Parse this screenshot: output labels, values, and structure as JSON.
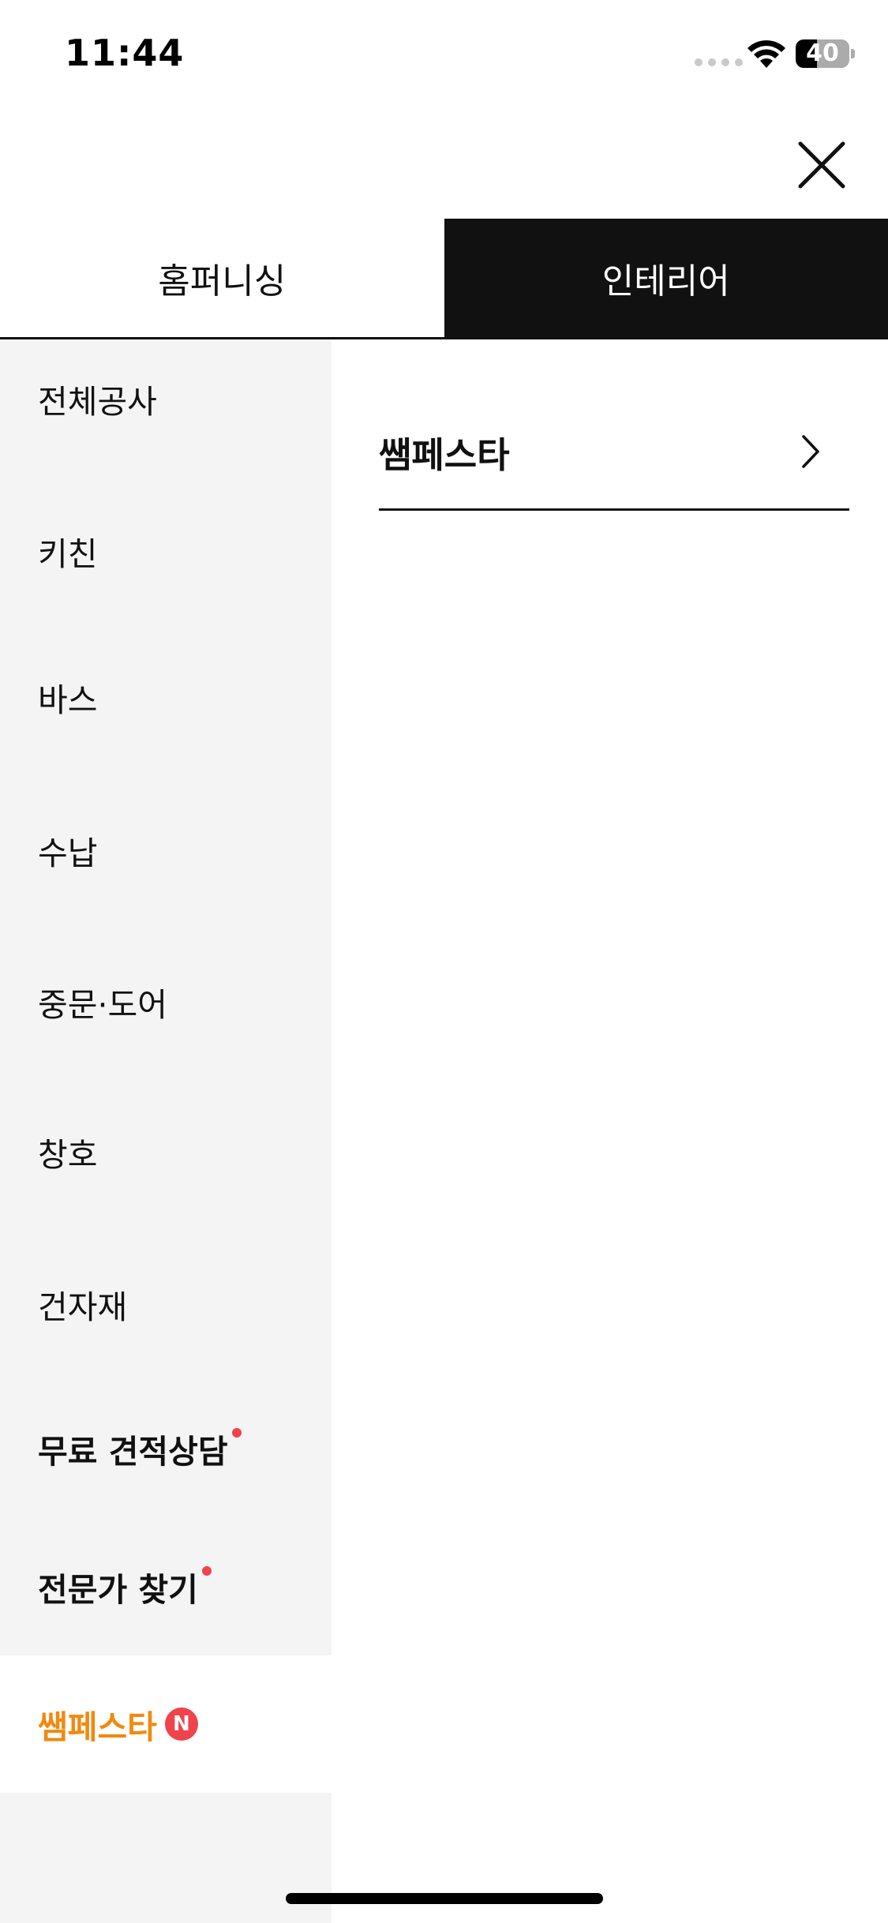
{
  "status_bar": {
    "time": "11:44",
    "battery_percent": 40,
    "battery_label": "40",
    "wifi_icon": "wifi-icon",
    "signal_icon": "cellular-signal-icon"
  },
  "close_icon": "close-icon",
  "tabs": [
    {
      "label": "홈퍼니싱",
      "active": false
    },
    {
      "label": "인테리어",
      "active": true
    }
  ],
  "sidebar": {
    "items": [
      {
        "label": "전체공사"
      },
      {
        "label": "키친"
      },
      {
        "label": "바스"
      },
      {
        "label": "수납"
      },
      {
        "label": "중문·도어"
      },
      {
        "label": "창호"
      },
      {
        "label": "건자재"
      },
      {
        "label": "무료 견적상담",
        "dot": true
      },
      {
        "label": "전문가 찾기",
        "dot": true
      },
      {
        "label": "쌤페스타",
        "badge": "N",
        "active": true
      }
    ]
  },
  "content": {
    "sub_link_label": "쌤페스타",
    "sub_link_icon": "chevron-right-icon"
  },
  "colors": {
    "active_tab_bg": "#111111",
    "sidebar_bg": "#f4f4f4",
    "accent_orange": "#f08a10",
    "badge_red": "#f0434c"
  }
}
